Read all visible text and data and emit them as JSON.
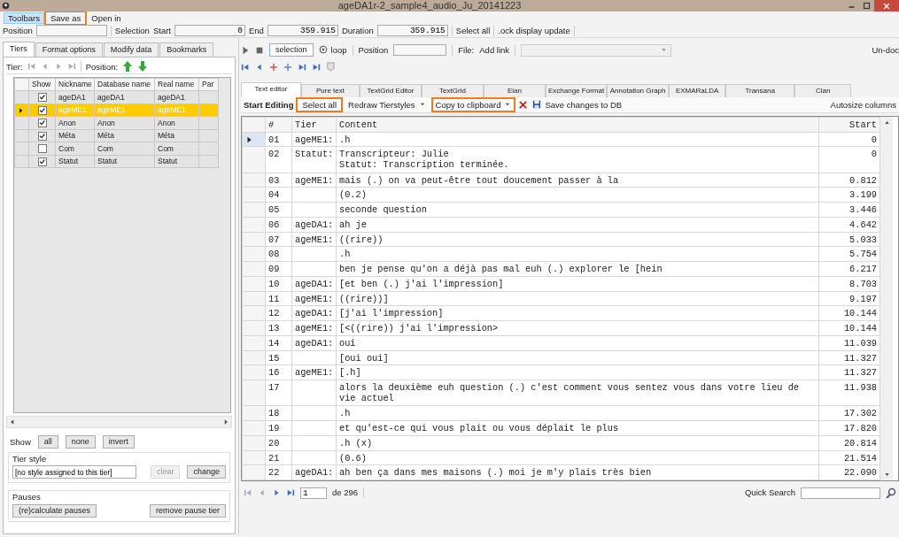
{
  "window": {
    "title": "ageDA1r-2_sample4_audio_Ju_20141223"
  },
  "menu": [
    {
      "label": "Toolbars",
      "selected": true,
      "highlighted": false
    },
    {
      "label": "Save as",
      "selected": false,
      "highlighted": true
    },
    {
      "label": "Open in",
      "selected": false,
      "highlighted": false
    }
  ],
  "selection_bar": {
    "position_label": "Position",
    "selection_label": "Selection",
    "start_label": "Start",
    "start": "0",
    "end_label": "End",
    "end": "359.915",
    "duration_label": "Duration",
    "duration": "359.915",
    "select_all": "Select all",
    "lock": ".ock display update"
  },
  "left_tabs": [
    {
      "label": "Tiers",
      "selected": true
    },
    {
      "label": "Format options",
      "selected": false
    },
    {
      "label": "Modify data",
      "selected": false
    },
    {
      "label": "Bookmarks",
      "selected": false
    }
  ],
  "tier_nav": {
    "label": "Tier:",
    "position_label": "Position:"
  },
  "tiers": {
    "columns": [
      "Show",
      "Nickname",
      "Database name",
      "Real name",
      "Par"
    ],
    "rows": [
      {
        "show": true,
        "nickname": "ageDA1",
        "database_name": "ageDA1",
        "real_name": "ageDA1",
        "selected": false
      },
      {
        "show": true,
        "nickname": "ageME1",
        "database_name": "ageME1",
        "real_name": "ageME1",
        "selected": true
      },
      {
        "show": true,
        "nickname": "Anon",
        "database_name": "Anon",
        "real_name": "Anon",
        "selected": false
      },
      {
        "show": true,
        "nickname": "Méta",
        "database_name": "Méta",
        "real_name": "Méta",
        "selected": false
      },
      {
        "show": false,
        "nickname": "Com",
        "database_name": "Com",
        "real_name": "Com",
        "selected": false
      },
      {
        "show": true,
        "nickname": "Statut",
        "database_name": "Statut",
        "real_name": "Statut",
        "selected": false
      }
    ]
  },
  "show_bar": {
    "label": "Show",
    "buttons": [
      "all",
      "none",
      "invert"
    ]
  },
  "tier_style": {
    "title": "Tier style",
    "value": "[no style assigned to this tier]",
    "clear": {
      "label": "clear",
      "disabled": true
    },
    "change": "change"
  },
  "pauses": {
    "title": "Pauses",
    "buttons": [
      "(re)calculate pauses",
      "remove pause tier"
    ]
  },
  "player": {
    "selection": "selection",
    "loop": "loop",
    "position_label": "Position",
    "file_label": "File:",
    "add_link": "Add link",
    "undo": "Un-doc"
  },
  "view_tabs": [
    {
      "label": "Text editor",
      "selected": true
    },
    {
      "label": "Pure text",
      "selected": false
    },
    {
      "label": "TextGrid Editor",
      "selected": false
    },
    {
      "label": "TextGrid",
      "selected": false
    },
    {
      "label": "Elan",
      "selected": false
    },
    {
      "label": "Exchange Format",
      "selected": false
    },
    {
      "label": "Annotation Graph",
      "selected": false
    },
    {
      "label": "EXMARaLDA",
      "selected": false
    },
    {
      "label": "Transana",
      "selected": false
    },
    {
      "label": "Clan",
      "selected": false
    }
  ],
  "editor_toolbar": [
    {
      "kind": "label",
      "label": "Start Editing",
      "highlighted": false
    },
    {
      "kind": "button",
      "label": "Select all",
      "highlighted": true
    },
    {
      "kind": "dropdown",
      "label": "Redraw Tierstyles",
      "highlighted": false
    },
    {
      "kind": "dropdown",
      "label": "Copy to clipboard",
      "highlighted": true
    },
    {
      "kind": "delete",
      "highlighted": false
    },
    {
      "kind": "save",
      "label": "Save changes to DB",
      "highlighted": false
    }
  ],
  "autosize": "Autosize columns",
  "segments": {
    "columns": [
      "#",
      "Tier",
      "Content",
      "Start"
    ],
    "rows": [
      {
        "number": "01",
        "tier": "ageME1:",
        "lines": [
          ".h"
        ],
        "start": "0",
        "current": true
      },
      {
        "number": "02",
        "tier": "Statut:",
        "lines": [
          "Transcripteur: Julie",
          "Statut: Transcription terminée."
        ],
        "start": "0",
        "current": false
      },
      {
        "number": "03",
        "tier": "ageME1:",
        "lines": [
          "mais (.) on va peut-être tout doucement passer à la"
        ],
        "start": "0.812",
        "current": false
      },
      {
        "number": "04",
        "lines": [
          "(0.2)"
        ],
        "start": "3.199",
        "current": false
      },
      {
        "number": "05",
        "lines": [
          "seconde question"
        ],
        "start": "3.446",
        "current": false
      },
      {
        "number": "06",
        "tier": "ageDA1:",
        "lines": [
          "ah je"
        ],
        "start": "4.642",
        "current": false
      },
      {
        "number": "07",
        "tier": "ageME1:",
        "lines": [
          "((rire))"
        ],
        "start": "5.033",
        "current": false
      },
      {
        "number": "08",
        "lines": [
          ".h"
        ],
        "start": "5.754",
        "current": false
      },
      {
        "number": "09",
        "lines": [
          "ben je pense qu'on a déjà pas mal euh (.) explorer le [hein"
        ],
        "start": "6.217",
        "current": false
      },
      {
        "number": "10",
        "tier": "ageDA1:",
        "lines": [
          "[et ben (.) j'ai l'impression]"
        ],
        "start": "8.703",
        "current": false
      },
      {
        "number": "11",
        "tier": "ageME1:",
        "lines": [
          "((rire))]"
        ],
        "start": "9.197",
        "current": false
      },
      {
        "number": "12",
        "tier": "ageDA1:",
        "lines": [
          "[j'ai l'impression]"
        ],
        "start": "10.144",
        "current": false
      },
      {
        "number": "13",
        "tier": "ageME1:",
        "lines": [
          "[<((rire)) j'ai l'impression>"
        ],
        "start": "10.144",
        "current": false
      },
      {
        "number": "14",
        "tier": "ageDA1:",
        "lines": [
          "oui"
        ],
        "start": "11.039",
        "current": false
      },
      {
        "number": "15",
        "lines": [
          "[oui oui]"
        ],
        "start": "11.327",
        "current": false
      },
      {
        "number": "16",
        "tier": "ageME1:",
        "lines": [
          "[.h]"
        ],
        "start": "11.327",
        "current": false
      },
      {
        "number": "17",
        "lines": [
          "alors la deuxième euh question (.) c'est comment vous sentez vous dans votre lieu de",
          "vie actuel"
        ],
        "start": "11.938",
        "current": false
      },
      {
        "number": "18",
        "lines": [
          ".h"
        ],
        "start": "17.302",
        "current": false
      },
      {
        "number": "19",
        "lines": [
          "et qu'est-ce qui vous plait ou vous déplait le plus"
        ],
        "start": "17.820",
        "current": false
      },
      {
        "number": "20",
        "lines": [
          ".h (x)"
        ],
        "start": "20.814",
        "current": false
      },
      {
        "number": "21",
        "lines": [
          "(0.6)"
        ],
        "start": "21.514",
        "current": false
      },
      {
        "number": "22",
        "tier": "ageDA1:",
        "lines": [
          "ah ben ça dans mes maisons (.) moi je m'y plais très bien"
        ],
        "start": "22.090",
        "current": false
      }
    ]
  },
  "pager": {
    "page": "1",
    "of": "de 296",
    "search_label": "Quick Search"
  }
}
